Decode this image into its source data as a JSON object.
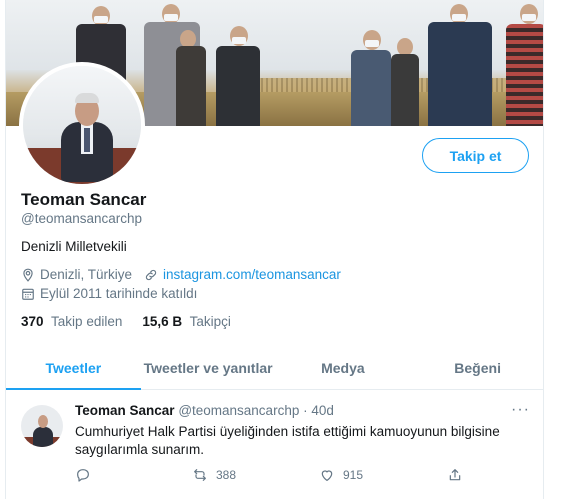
{
  "profile": {
    "name": "Teoman Sancar",
    "handle": "@teomansancarchp",
    "bio": "Denizli Milletvekili",
    "location": "Denizli, Türkiye",
    "website": "instagram.com/teomansancar",
    "joined": "Eylül 2011 tarihinde katıldı",
    "following_count": "370",
    "following_label": "Takip edilen",
    "followers_count": "15,6 B",
    "followers_label": "Takipçi",
    "follow_button": "Takip et"
  },
  "tabs": [
    {
      "label": "Tweetler",
      "active": true
    },
    {
      "label": "Tweetler ve yanıtlar",
      "active": false
    },
    {
      "label": "Medya",
      "active": false
    },
    {
      "label": "Beğeni",
      "active": false
    }
  ],
  "tweet": {
    "name": "Teoman Sancar",
    "handle": "@teomansancarchp",
    "separator": "·",
    "age": "40d",
    "text": "Cumhuriyet Halk Partisi üyeliğinden istifa ettiğimi kamuoyunun bilgisine saygılarımla sunarım.",
    "more": "···",
    "retweets": "388",
    "likes": "915"
  },
  "icons": {
    "location": "location-pin-icon",
    "link": "link-icon",
    "calendar": "calendar-icon",
    "reply": "reply-icon",
    "retweet": "retweet-icon",
    "like": "heart-icon",
    "share": "share-icon"
  },
  "colors": {
    "accent": "#1da1f2",
    "link": "#1b95e0",
    "secondary_text": "#657786",
    "primary_text": "#14171a",
    "border": "#e6ecf0"
  }
}
